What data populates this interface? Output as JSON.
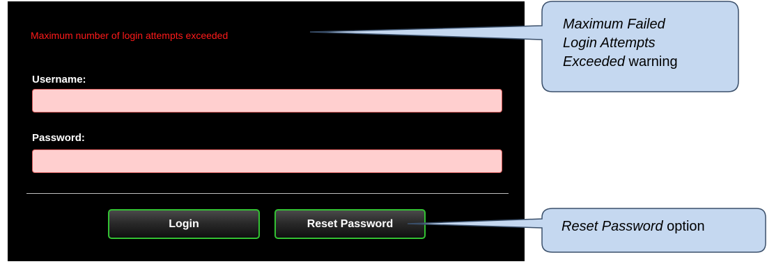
{
  "login_panel": {
    "error_message": "Maximum number of login attempts exceeded",
    "username_label": "Username:",
    "username_value": "",
    "password_label": "Password:",
    "password_value": "",
    "login_button": "Login",
    "reset_button": "Reset Password"
  },
  "callouts": {
    "warning": {
      "line1": "Maximum Failed",
      "line2": "Login Attempts",
      "line3_italic": "Exceeded",
      "line3_plain": " warning"
    },
    "reset": {
      "italic": "Reset Password",
      "plain": " option"
    }
  },
  "colors": {
    "panel_background": "#000000",
    "error_text": "#ff1a1a",
    "field_background": "#ffcfcf",
    "field_border": "#d65a5a",
    "button_border": "#33c233",
    "callout_fill": "#c5d8f0",
    "callout_border": "#3a4f6a"
  }
}
